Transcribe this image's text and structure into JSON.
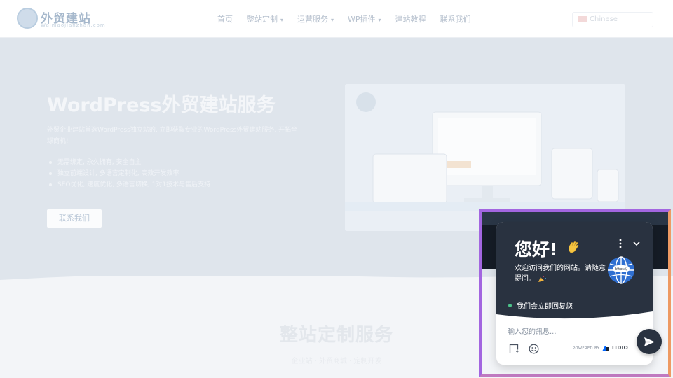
{
  "site": {
    "logo_name": "外贸建站",
    "logo_sub": "Waimaojianzhan.com"
  },
  "nav": {
    "items": [
      {
        "label": "首页",
        "has_dropdown": false
      },
      {
        "label": "整站定制",
        "has_dropdown": true
      },
      {
        "label": "运营服务",
        "has_dropdown": true
      },
      {
        "label": "WP插件",
        "has_dropdown": true
      },
      {
        "label": "建站教程",
        "has_dropdown": false
      },
      {
        "label": "联系我们",
        "has_dropdown": false
      }
    ],
    "language": "Chinese"
  },
  "hero": {
    "title": "WordPress外贸建站服务",
    "description": "外贸企业建站首选WordPress独立站的, 立即获取专业的WordPress外贸建站服务, 开拓全球商机!",
    "bullets": [
      "无需绑定, 永久拥有, 安全自主",
      "独立前端设计, 多语言定制化, 高效开发效率",
      "SEO优化, 速度优化, 多语言切换, 1对1技术与售后支持"
    ],
    "cta_label": "联系我们"
  },
  "section": {
    "title": "整站定制服务",
    "subtitle": "企业站 · 外贸商城 · 定制开发"
  },
  "chat": {
    "greeting": "您好!",
    "welcome_text": "欢迎访问我们的网站。请随意提问。",
    "avatar_label": "https://",
    "status_text": "我们会立即回复您",
    "status_color": "#4bc48a",
    "input_placeholder": "輸入您的訊息...",
    "powered_by": "POWERED BY",
    "brand_name": "TIDIO",
    "header_color": "#293240",
    "highlight_colors": [
      "#a366e0",
      "#ee9a63"
    ]
  }
}
